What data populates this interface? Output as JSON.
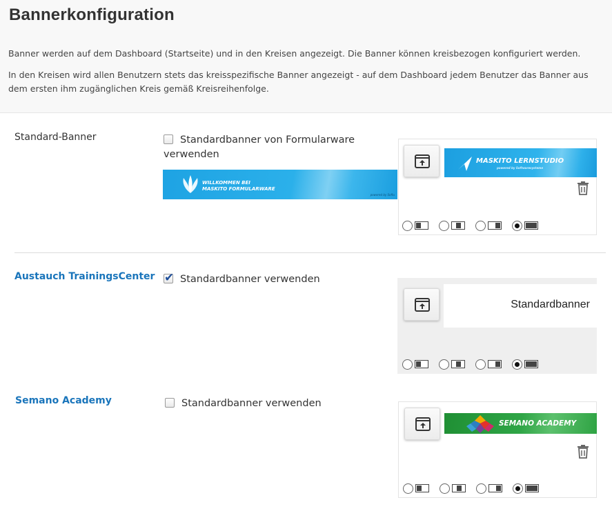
{
  "page": {
    "title": "Bannerkonfiguration",
    "description_1": "Banner werden auf dem Dashboard (Startseite) und in den Kreisen angezeigt. Die Banner können kreisbezogen konfiguriert werden.",
    "description_2": "In den Kreisen wird allen Benutzern stets das kreisspezifische Banner angezeigt - auf dem Dashboard jedem Benutzer das Banner aus dem ersten ihm zugänglichen Kreis gemäß Kreisreihenfolge."
  },
  "sections": [
    {
      "label": "Standard-Banner",
      "checkbox_label": "Standardbanner von Formularware verwenden",
      "checked": false,
      "default_banner": {
        "line1": "WILLKOMMEN BEI",
        "line2": "MASKITO FORMULARWARE",
        "footer": "powered by Softu"
      },
      "preview": {
        "banner_text": "MASKITO LERNSTUDIO",
        "banner_sub": "powered by Softwaresysteme"
      },
      "selected_layout": 4
    },
    {
      "label": "Austauch TrainingsCenter",
      "checkbox_label": "Standardbanner verwenden",
      "checked": true,
      "preview": {
        "banner_text": "Standardbanner"
      },
      "selected_layout": 4
    },
    {
      "label": "Semano Academy",
      "checkbox_label": "Standardbanner verwenden",
      "checked": false,
      "preview": {
        "banner_text": "SEMANO ACADEMY"
      },
      "selected_layout": 4
    }
  ],
  "icons": {
    "upload": "upload-icon",
    "delete": "trash-icon",
    "layouts": [
      "layout-left-icon",
      "layout-center-icon",
      "layout-right-icon",
      "layout-full-icon"
    ]
  },
  "colors": {
    "link": "#1a75bb",
    "banner_blue": "#1ea3e3",
    "banner_green": "#2e9e3e"
  }
}
